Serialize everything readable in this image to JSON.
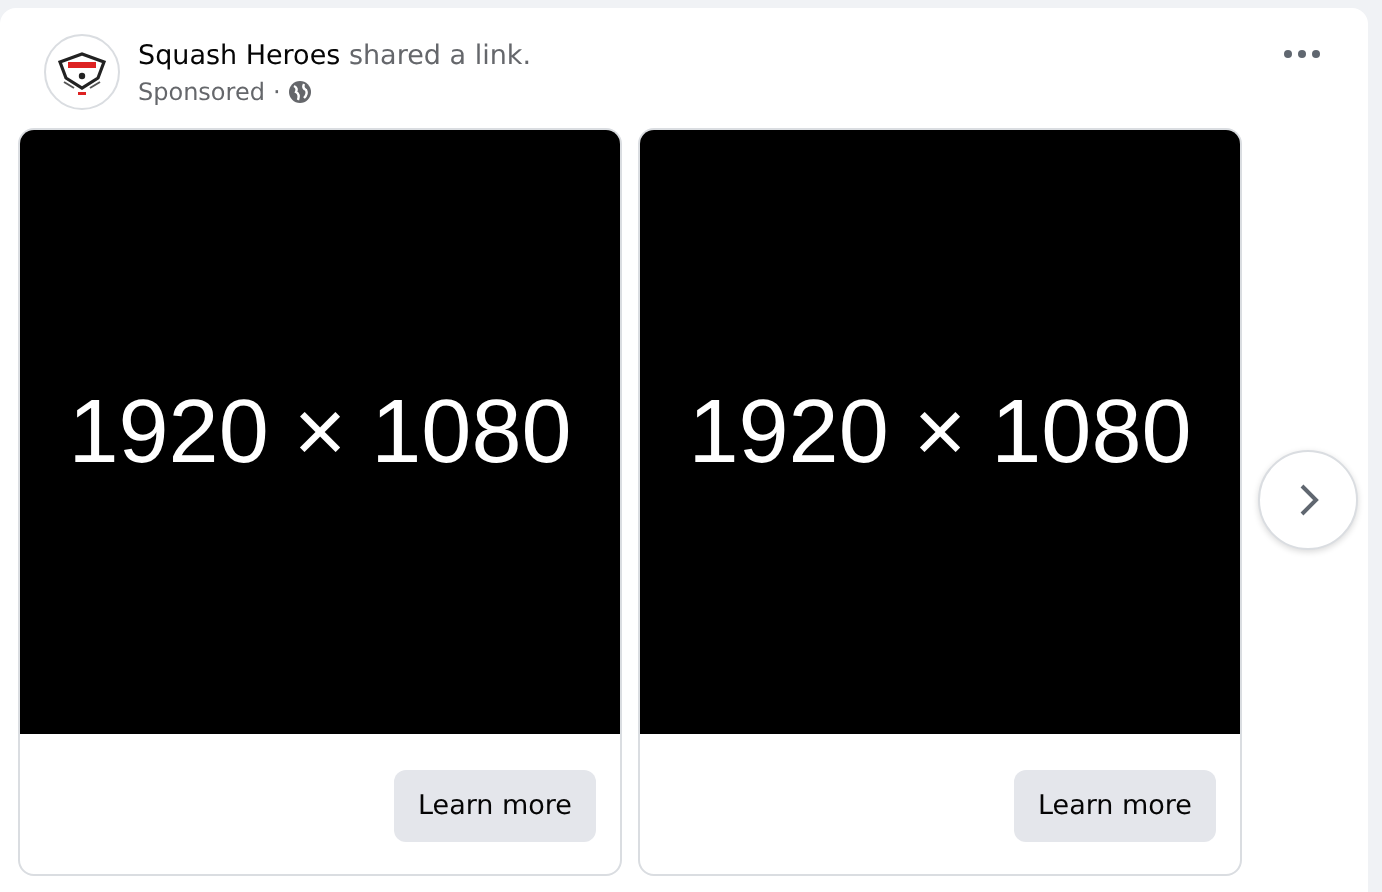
{
  "post": {
    "author": "Squash Heroes",
    "action": "shared a link.",
    "meta": "Sponsored",
    "separator": "·"
  },
  "carousel": [
    {
      "image_text": "1920 × 1080",
      "button": "Learn more"
    },
    {
      "image_text": "1920 × 1080",
      "button": "Learn more"
    }
  ]
}
